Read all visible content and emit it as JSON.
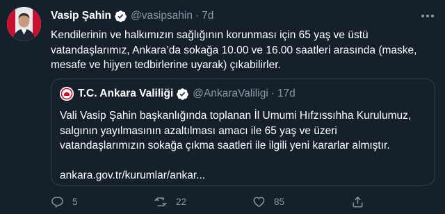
{
  "tweet": {
    "author_name": "Vasip Şahin",
    "handle": "@vasipsahin",
    "separator": "·",
    "time": "7d",
    "text_lines": [
      "Kendilerinin ve halkımızın sağlığının korunması için 65 yaş ve üstü",
      "vatandaşlarımız, Ankara’da sokağa 10.00 ve 16.00 saatleri arasında (maske,",
      "mesafe ve hijyen tedbirlerine uyarak) çıkabilirler."
    ]
  },
  "quoted_tweet": {
    "author_name": "T.C. Ankara Valiliği",
    "handle": "@AnkaraValiligi",
    "separator": "·",
    "time": "17d",
    "text_lines": [
      "Vali Vasip Şahin başkanlığında toplanan İl Umumi Hıfzıssıhha Kurulumuz,",
      "salgının yayılmasının azaltılması amacı ile 65 yaş ve üzeri",
      "vatandaşlarımızın sokağa çıkma saatleri ile ilgili yeni kararlar almıştır."
    ],
    "link": "ankara.gov.tr/kurumlar/ankar..."
  },
  "actions": {
    "reply_count": "5",
    "retweet_count": "22",
    "like_count": "85"
  },
  "colors": {
    "background": "#15202b",
    "secondary_text": "#8899a6",
    "verified": "#1da1f2",
    "border": "#38444d"
  }
}
